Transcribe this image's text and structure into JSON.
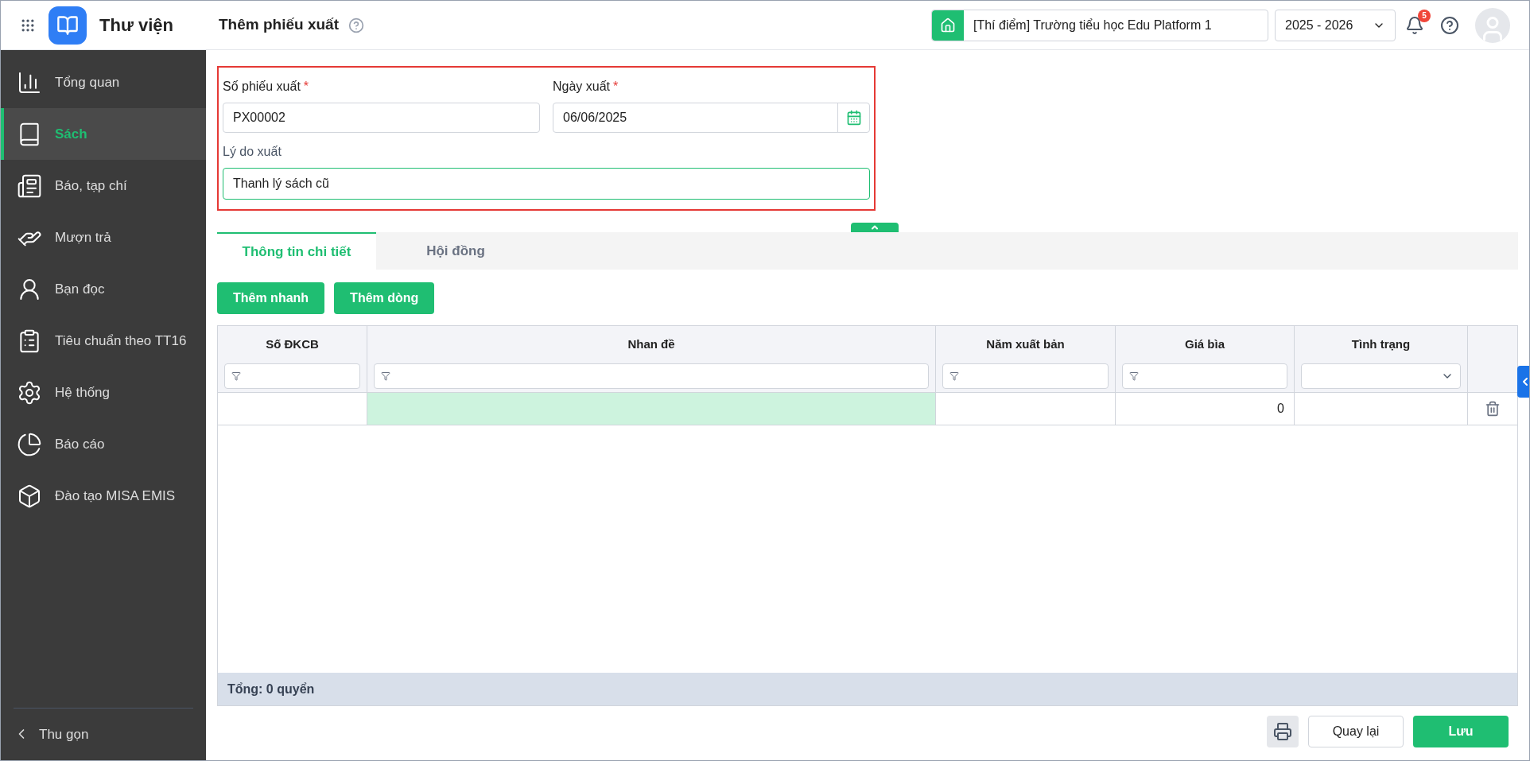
{
  "app": {
    "title": "Thư viện"
  },
  "header": {
    "page_title": "Thêm phiếu xuất",
    "school": "[Thí điểm] Trường tiểu học Edu Platform 1",
    "year": "2025 - 2026",
    "notifications": "5"
  },
  "sidebar": {
    "items": [
      {
        "label": "Tổng quan",
        "selected": false
      },
      {
        "label": "Sách",
        "selected": true
      },
      {
        "label": "Báo, tạp chí",
        "selected": false
      },
      {
        "label": "Mượn trả",
        "selected": false
      },
      {
        "label": "Bạn đọc",
        "selected": false
      },
      {
        "label": "Tiêu chuẩn theo TT16",
        "selected": false
      },
      {
        "label": "Hệ thống",
        "selected": false
      },
      {
        "label": "Báo cáo",
        "selected": false
      },
      {
        "label": "Đào tạo MISA EMIS",
        "selected": false
      }
    ],
    "collapse": "Thu gọn"
  },
  "form": {
    "number_label": "Số phiếu xuất",
    "number_required_mark": "*",
    "number_value": "PX00002",
    "date_label": "Ngày xuất",
    "date_required_mark": "*",
    "date_value": "06/06/2025",
    "reason_label": "Lý do xuất",
    "reason_value": "Thanh lý sách cũ"
  },
  "tabs": [
    {
      "label": "Thông tin chi tiết",
      "selected": true
    },
    {
      "label": "Hội đồng",
      "selected": false
    }
  ],
  "actions": [
    "Thêm nhanh",
    "Thêm dòng"
  ],
  "table": {
    "columns": [
      {
        "label": "Số ĐKCB",
        "kind": "text"
      },
      {
        "label": "Nhan đề",
        "kind": "text"
      },
      {
        "label": "Năm xuất bản",
        "kind": "text"
      },
      {
        "label": "Giá bìa",
        "kind": "text"
      },
      {
        "label": "Tình trạng",
        "kind": "select"
      }
    ],
    "rows": [
      {
        "cells": [
          {
            "selected": false
          },
          {
            "selected": true
          },
          {
            "selected": false
          },
          {
            "value": "0",
            "selected": false
          },
          {
            "selected": false
          }
        ]
      }
    ],
    "footer": "Tổng: 0 quyển"
  },
  "buttons": {
    "back": "Quay lại",
    "save": "Lưu"
  }
}
